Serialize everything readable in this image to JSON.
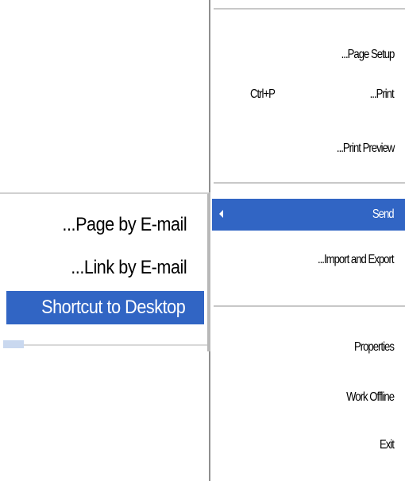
{
  "colors": {
    "highlight": "#3165c4",
    "highlight_text": "#ffffff",
    "menu_text": "#000000"
  },
  "file_menu": {
    "items": [
      {
        "label": "...Page Setup"
      },
      {
        "label": "...Print",
        "shortcut": "Ctrl+P"
      },
      {
        "label": "...Print Preview"
      },
      {
        "label": "Send",
        "submenu_arrow_icon": "triangle-left-icon",
        "highlighted": true
      },
      {
        "label": "...Import and Export"
      },
      {
        "label": "Properties"
      },
      {
        "label": "Work Offline"
      },
      {
        "label": "Exit"
      }
    ]
  },
  "send_submenu": {
    "items": [
      {
        "label": "...Page by E-mail"
      },
      {
        "label": "...Link by E-mail"
      },
      {
        "label": "Shortcut to Desktop",
        "highlighted": true
      }
    ]
  }
}
